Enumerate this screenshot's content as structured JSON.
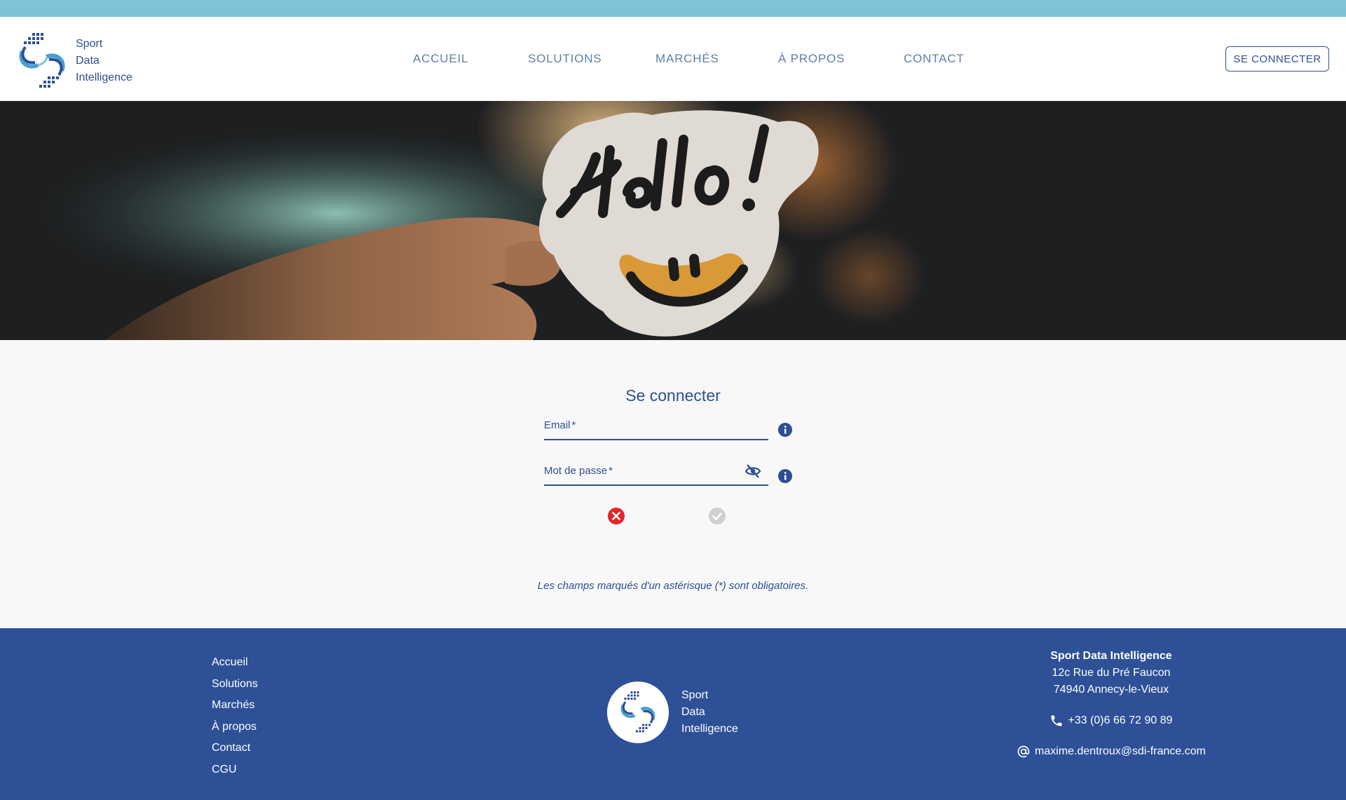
{
  "brand": {
    "line1": "Sport",
    "line2": "Data",
    "line3": "Intelligence"
  },
  "nav": {
    "items": [
      {
        "label": "ACCUEIL"
      },
      {
        "label": "SOLUTIONS"
      },
      {
        "label": "MARCHÉS"
      },
      {
        "label": "À PROPOS"
      },
      {
        "label": "CONTACT"
      }
    ]
  },
  "header": {
    "login_button": "SE CONNECTER"
  },
  "hero": {
    "sticker_text": "Hello!"
  },
  "login": {
    "title": "Se connecter",
    "email_label": "Email",
    "password_label": "Mot de passe",
    "required_marker": "*",
    "required_note": "Les champs marqués d'un astérisque (*) sont obligatoires."
  },
  "footer": {
    "links": [
      "Accueil",
      "Solutions",
      "Marchés",
      "À propos",
      "Contact",
      "CGU"
    ],
    "company": "Sport Data Intelligence",
    "address_line1": "12c Rue du Pré Faucon",
    "address_line2": "74940 Annecy-le-Vieux",
    "phone": "+33 (0)6 66 72 90 89",
    "email": "maxime.dentroux@sdi-france.com"
  },
  "colors": {
    "top_strip": "#7fc3d7",
    "primary": "#2d4f93",
    "footer_bg": "#2d5097",
    "nav_text": "#5d7fa6",
    "cancel_red": "#e3262b",
    "confirm_grey": "#d0d0d0"
  },
  "icons": {
    "info": "info-icon",
    "eye_off": "eye-off-icon",
    "cancel": "close-circle-icon",
    "confirm": "check-circle-icon",
    "phone": "phone-icon",
    "email": "at-sign-icon"
  }
}
